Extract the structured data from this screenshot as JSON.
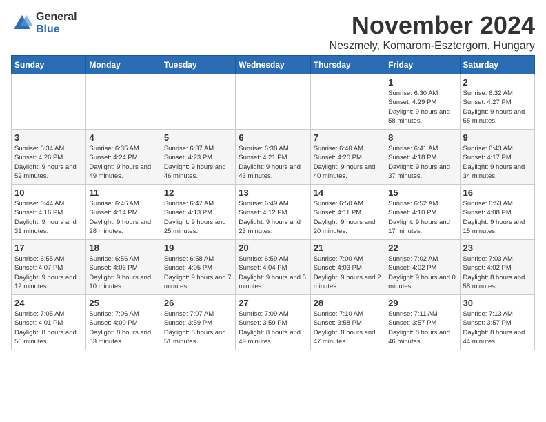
{
  "logo": {
    "general": "General",
    "blue": "Blue"
  },
  "title": "November 2024",
  "subtitle": "Neszmely, Komarom-Esztergom, Hungary",
  "days_header": [
    "Sunday",
    "Monday",
    "Tuesday",
    "Wednesday",
    "Thursday",
    "Friday",
    "Saturday"
  ],
  "weeks": [
    [
      {
        "day": "",
        "info": ""
      },
      {
        "day": "",
        "info": ""
      },
      {
        "day": "",
        "info": ""
      },
      {
        "day": "",
        "info": ""
      },
      {
        "day": "",
        "info": ""
      },
      {
        "day": "1",
        "info": "Sunrise: 6:30 AM\nSunset: 4:29 PM\nDaylight: 9 hours and 58 minutes."
      },
      {
        "day": "2",
        "info": "Sunrise: 6:32 AM\nSunset: 4:27 PM\nDaylight: 9 hours and 55 minutes."
      }
    ],
    [
      {
        "day": "3",
        "info": "Sunrise: 6:34 AM\nSunset: 4:26 PM\nDaylight: 9 hours and 52 minutes."
      },
      {
        "day": "4",
        "info": "Sunrise: 6:35 AM\nSunset: 4:24 PM\nDaylight: 9 hours and 49 minutes."
      },
      {
        "day": "5",
        "info": "Sunrise: 6:37 AM\nSunset: 4:23 PM\nDaylight: 9 hours and 46 minutes."
      },
      {
        "day": "6",
        "info": "Sunrise: 6:38 AM\nSunset: 4:21 PM\nDaylight: 9 hours and 43 minutes."
      },
      {
        "day": "7",
        "info": "Sunrise: 6:40 AM\nSunset: 4:20 PM\nDaylight: 9 hours and 40 minutes."
      },
      {
        "day": "8",
        "info": "Sunrise: 6:41 AM\nSunset: 4:18 PM\nDaylight: 9 hours and 37 minutes."
      },
      {
        "day": "9",
        "info": "Sunrise: 6:43 AM\nSunset: 4:17 PM\nDaylight: 9 hours and 34 minutes."
      }
    ],
    [
      {
        "day": "10",
        "info": "Sunrise: 6:44 AM\nSunset: 4:16 PM\nDaylight: 9 hours and 31 minutes."
      },
      {
        "day": "11",
        "info": "Sunrise: 6:46 AM\nSunset: 4:14 PM\nDaylight: 9 hours and 28 minutes."
      },
      {
        "day": "12",
        "info": "Sunrise: 6:47 AM\nSunset: 4:13 PM\nDaylight: 9 hours and 25 minutes."
      },
      {
        "day": "13",
        "info": "Sunrise: 6:49 AM\nSunset: 4:12 PM\nDaylight: 9 hours and 23 minutes."
      },
      {
        "day": "14",
        "info": "Sunrise: 6:50 AM\nSunset: 4:11 PM\nDaylight: 9 hours and 20 minutes."
      },
      {
        "day": "15",
        "info": "Sunrise: 6:52 AM\nSunset: 4:10 PM\nDaylight: 9 hours and 17 minutes."
      },
      {
        "day": "16",
        "info": "Sunrise: 6:53 AM\nSunset: 4:08 PM\nDaylight: 9 hours and 15 minutes."
      }
    ],
    [
      {
        "day": "17",
        "info": "Sunrise: 6:55 AM\nSunset: 4:07 PM\nDaylight: 9 hours and 12 minutes."
      },
      {
        "day": "18",
        "info": "Sunrise: 6:56 AM\nSunset: 4:06 PM\nDaylight: 9 hours and 10 minutes."
      },
      {
        "day": "19",
        "info": "Sunrise: 6:58 AM\nSunset: 4:05 PM\nDaylight: 9 hours and 7 minutes."
      },
      {
        "day": "20",
        "info": "Sunrise: 6:59 AM\nSunset: 4:04 PM\nDaylight: 9 hours and 5 minutes."
      },
      {
        "day": "21",
        "info": "Sunrise: 7:00 AM\nSunset: 4:03 PM\nDaylight: 9 hours and 2 minutes."
      },
      {
        "day": "22",
        "info": "Sunrise: 7:02 AM\nSunset: 4:02 PM\nDaylight: 9 hours and 0 minutes."
      },
      {
        "day": "23",
        "info": "Sunrise: 7:03 AM\nSunset: 4:02 PM\nDaylight: 8 hours and 58 minutes."
      }
    ],
    [
      {
        "day": "24",
        "info": "Sunrise: 7:05 AM\nSunset: 4:01 PM\nDaylight: 8 hours and 56 minutes."
      },
      {
        "day": "25",
        "info": "Sunrise: 7:06 AM\nSunset: 4:00 PM\nDaylight: 8 hours and 53 minutes."
      },
      {
        "day": "26",
        "info": "Sunrise: 7:07 AM\nSunset: 3:59 PM\nDaylight: 8 hours and 51 minutes."
      },
      {
        "day": "27",
        "info": "Sunrise: 7:09 AM\nSunset: 3:59 PM\nDaylight: 8 hours and 49 minutes."
      },
      {
        "day": "28",
        "info": "Sunrise: 7:10 AM\nSunset: 3:58 PM\nDaylight: 8 hours and 47 minutes."
      },
      {
        "day": "29",
        "info": "Sunrise: 7:11 AM\nSunset: 3:57 PM\nDaylight: 8 hours and 46 minutes."
      },
      {
        "day": "30",
        "info": "Sunrise: 7:13 AM\nSunset: 3:57 PM\nDaylight: 8 hours and 44 minutes."
      }
    ]
  ]
}
